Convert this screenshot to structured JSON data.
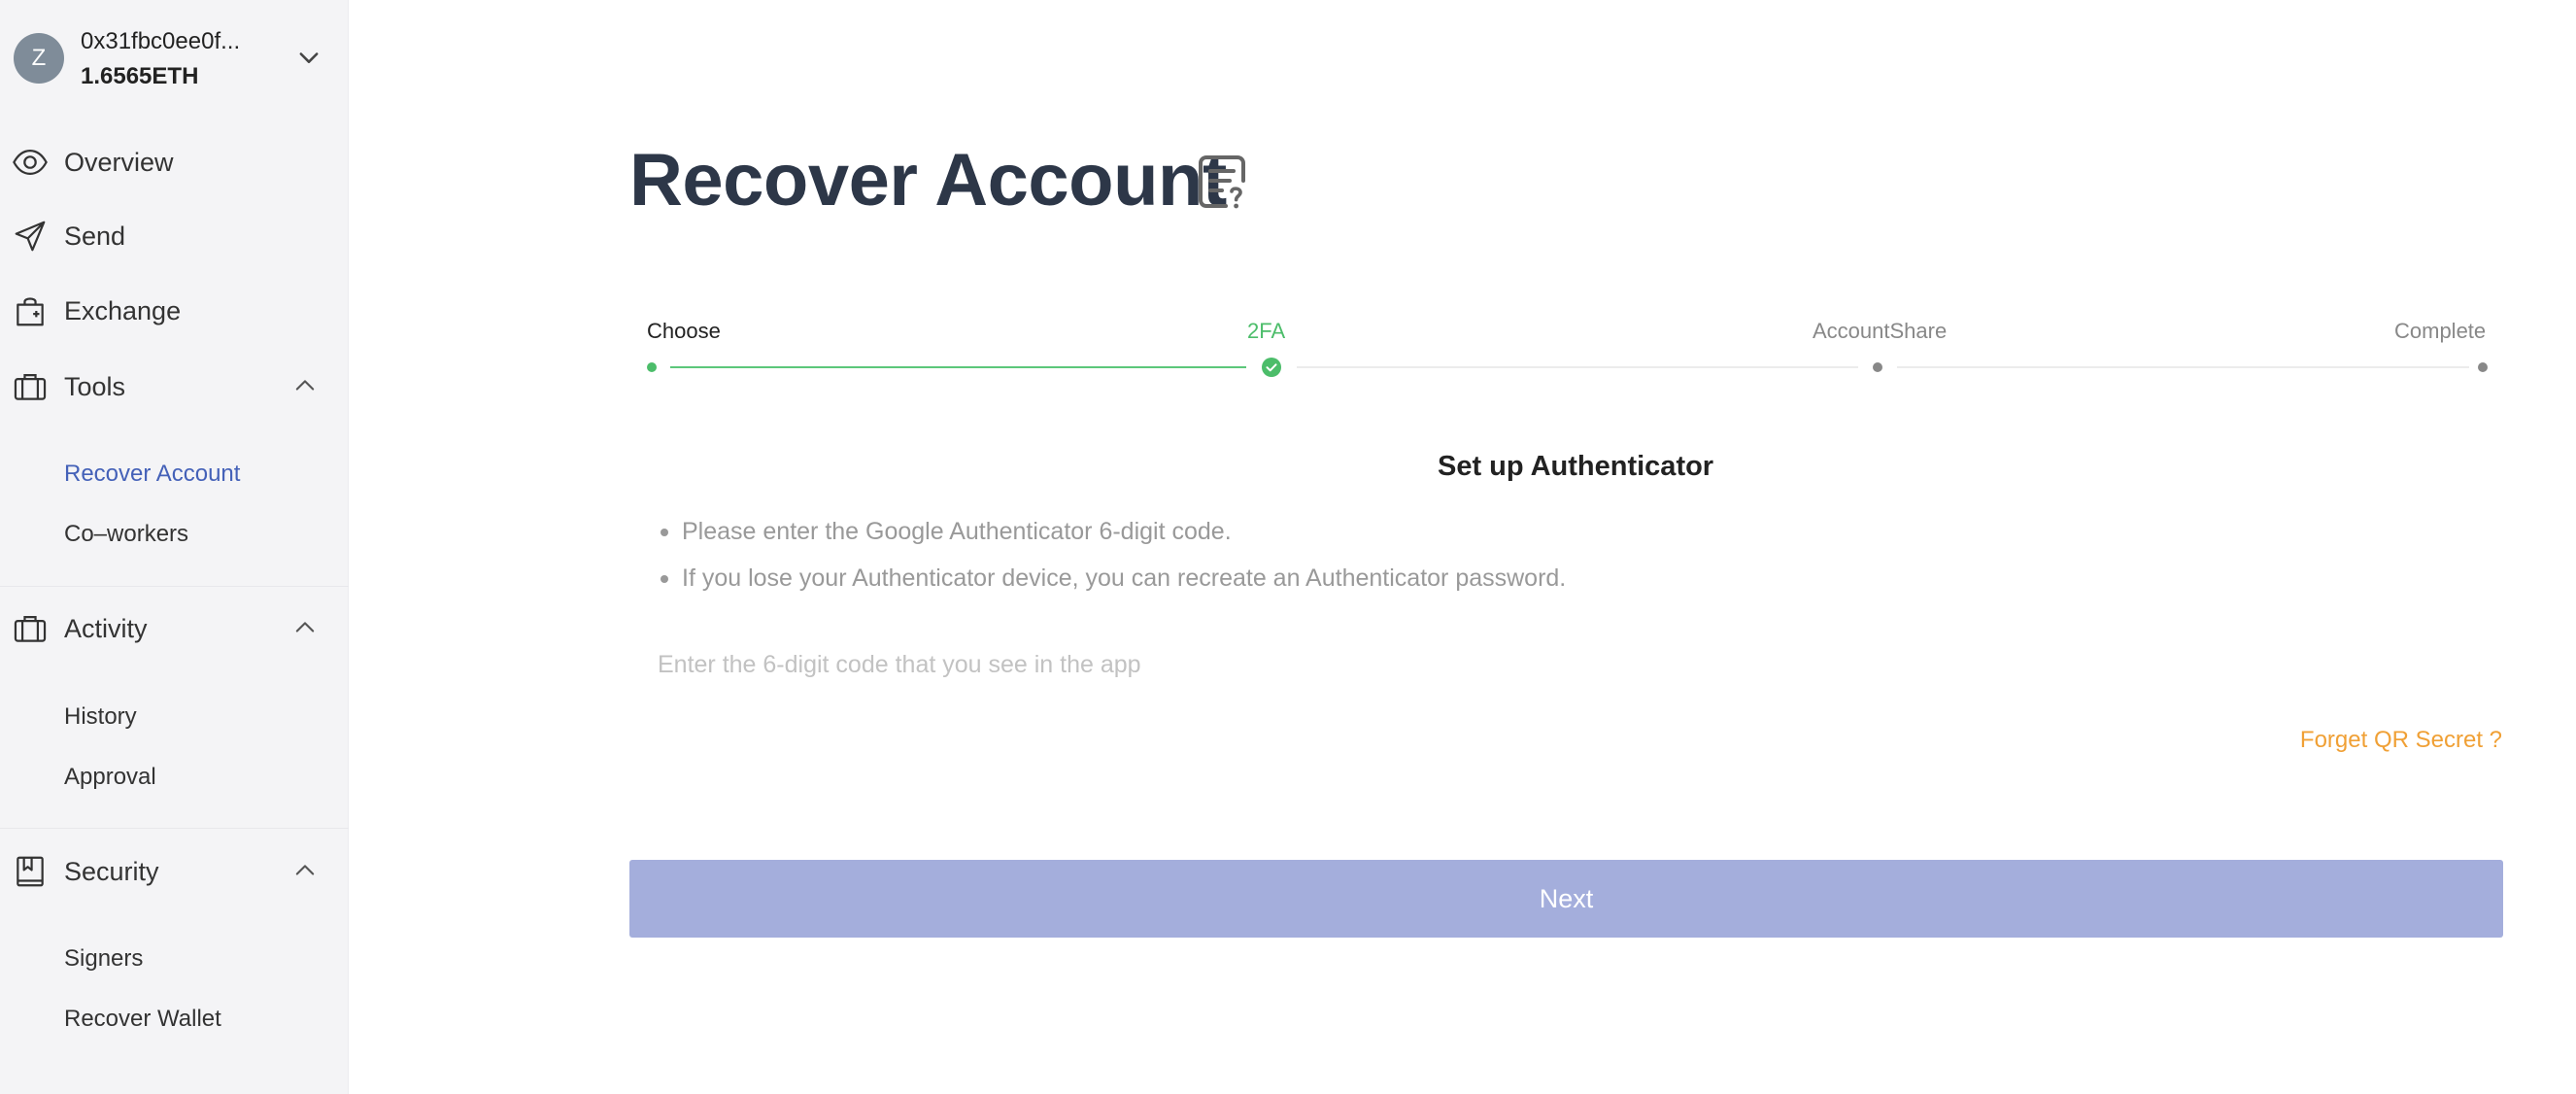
{
  "account": {
    "avatar_letter": "Z",
    "address": "0x31fbc0ee0f...",
    "balance": "1.6565ETH"
  },
  "sidebar": {
    "overview": "Overview",
    "send": "Send",
    "exchange": "Exchange",
    "tools": {
      "label": "Tools",
      "items": [
        "Recover Account",
        "Co–workers"
      ]
    },
    "activity": {
      "label": "Activity",
      "items": [
        "History",
        "Approval"
      ]
    },
    "security": {
      "label": "Security",
      "items": [
        "Signers",
        "Recover Wallet"
      ]
    },
    "active_item": "Recover Account"
  },
  "page": {
    "title": "Recover Account",
    "title_icon": "document-question-icon"
  },
  "steps": [
    {
      "label": "Choose",
      "status": "done"
    },
    {
      "label": "2FA",
      "status": "current"
    },
    {
      "label": "AccountShare",
      "status": "pending"
    },
    {
      "label": "Complete",
      "status": "pending"
    }
  ],
  "authenticator": {
    "heading": "Set up Authenticator",
    "instructions": [
      "Please enter the Google Authenticator 6-digit code.",
      "If you lose your Authenticator device, you can recreate an Authenticator password."
    ],
    "code_value": "",
    "code_placeholder": "Enter the 6-digit code that you see in the app",
    "forget_link": "Forget QR Secret ?",
    "next_label": "Next"
  },
  "colors": {
    "sidebar_bg": "#f4f4f6",
    "active_link": "#4461b8",
    "step_done": "#4cbd6a",
    "link_orange": "#f0a035",
    "button_disabled": "#a4aedc"
  }
}
